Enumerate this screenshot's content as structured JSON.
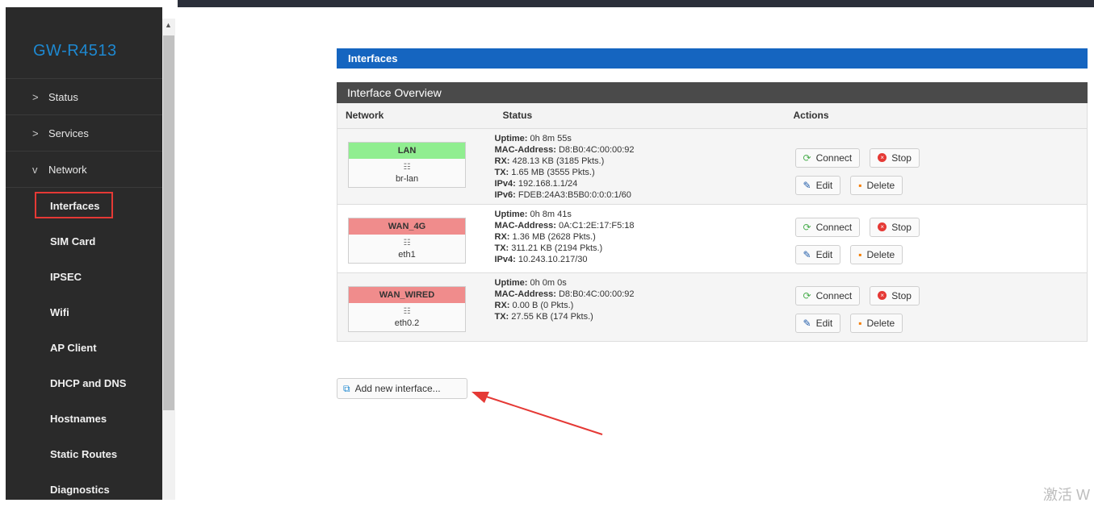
{
  "brand": "GW-R4513",
  "nav": [
    {
      "label": "Status",
      "chevron": ">"
    },
    {
      "label": "Services",
      "chevron": ">"
    },
    {
      "label": "Network",
      "chevron": "v"
    }
  ],
  "subnav": [
    "Interfaces",
    "SIM Card",
    "IPSEC",
    "Wifi",
    "AP Client",
    "DHCP and DNS",
    "Hostnames",
    "Static Routes",
    "Diagnostics"
  ],
  "active_subnav": "Interfaces",
  "page_title": "Interfaces",
  "overview_title": "Interface Overview",
  "columns": {
    "network": "Network",
    "status": "Status",
    "actions": "Actions"
  },
  "interfaces": [
    {
      "name": "LAN",
      "device": "br-lan",
      "icon": "bridge-icon",
      "color": "#90ee90",
      "status": [
        {
          "k": "Uptime:",
          "v": "0h 8m 55s"
        },
        {
          "k": "MAC-Address:",
          "v": "D8:B0:4C:00:00:92"
        },
        {
          "k": "RX:",
          "v": "428.13 KB (3185 Pkts.)"
        },
        {
          "k": "TX:",
          "v": "1.65 MB (3555 Pkts.)"
        },
        {
          "k": "IPv4:",
          "v": "192.168.1.1/24"
        },
        {
          "k": "IPv6:",
          "v": "FDEB:24A3:B5B0:0:0:0:1/60"
        }
      ]
    },
    {
      "name": "WAN_4G",
      "device": "eth1",
      "icon": "ethernet-icon",
      "color": "#f08c8c",
      "status": [
        {
          "k": "Uptime:",
          "v": "0h 8m 41s"
        },
        {
          "k": "MAC-Address:",
          "v": "0A:C1:2E:17:F5:18"
        },
        {
          "k": "RX:",
          "v": "1.36 MB (2628 Pkts.)"
        },
        {
          "k": "TX:",
          "v": "311.21 KB (2194 Pkts.)"
        },
        {
          "k": "IPv4:",
          "v": "10.243.10.217/30"
        }
      ]
    },
    {
      "name": "WAN_WIRED",
      "device": "eth0.2",
      "icon": "switch-icon",
      "color": "#f08c8c",
      "status": [
        {
          "k": "Uptime:",
          "v": "0h 0m 0s"
        },
        {
          "k": "MAC-Address:",
          "v": "D8:B0:4C:00:00:92"
        },
        {
          "k": "RX:",
          "v": "0.00 B (0 Pkts.)"
        },
        {
          "k": "TX:",
          "v": "27.55 KB (174 Pkts.)"
        }
      ]
    }
  ],
  "buttons": {
    "connect": "Connect",
    "stop": "Stop",
    "edit": "Edit",
    "delete": "Delete"
  },
  "add_interface": "Add new interface...",
  "watermark": "激活 W",
  "colors": {
    "accent": "#1565c0",
    "sidebar": "#2a2a2a",
    "highlight": "#e53935",
    "arrow": "#e53935"
  }
}
